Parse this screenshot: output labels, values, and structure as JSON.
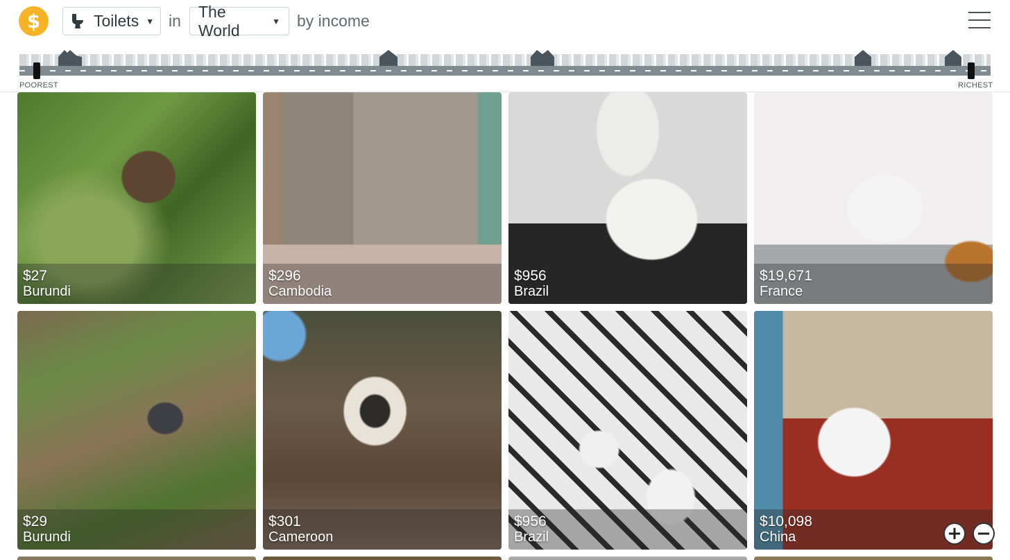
{
  "header": {
    "logo_symbol": "$",
    "topic_label": "Toilets",
    "in_label": "in",
    "region_label": "The World",
    "by_label": "by income"
  },
  "street": {
    "left_label": "POOREST",
    "right_label": "RICHEST"
  },
  "cards": [
    {
      "income": "$27",
      "country": "Burundi"
    },
    {
      "income": "$296",
      "country": "Cambodia"
    },
    {
      "income": "$956",
      "country": "Brazil"
    },
    {
      "income": "$19,671",
      "country": "France"
    },
    {
      "income": "$29",
      "country": "Burundi"
    },
    {
      "income": "$301",
      "country": "Cameroon"
    },
    {
      "income": "$956",
      "country": "Brazil"
    },
    {
      "income": "$10,098",
      "country": "China"
    }
  ],
  "zoom": {
    "plus": "+",
    "minus": "−"
  },
  "colors": {
    "accent": "#f6b325",
    "road": "#7f8b91",
    "house_dark": "#4c555c"
  },
  "icons": [
    "toilet-icon",
    "caret-down-icon",
    "menu-icon",
    "house-icon",
    "zoom-in-icon",
    "zoom-out-icon"
  ]
}
